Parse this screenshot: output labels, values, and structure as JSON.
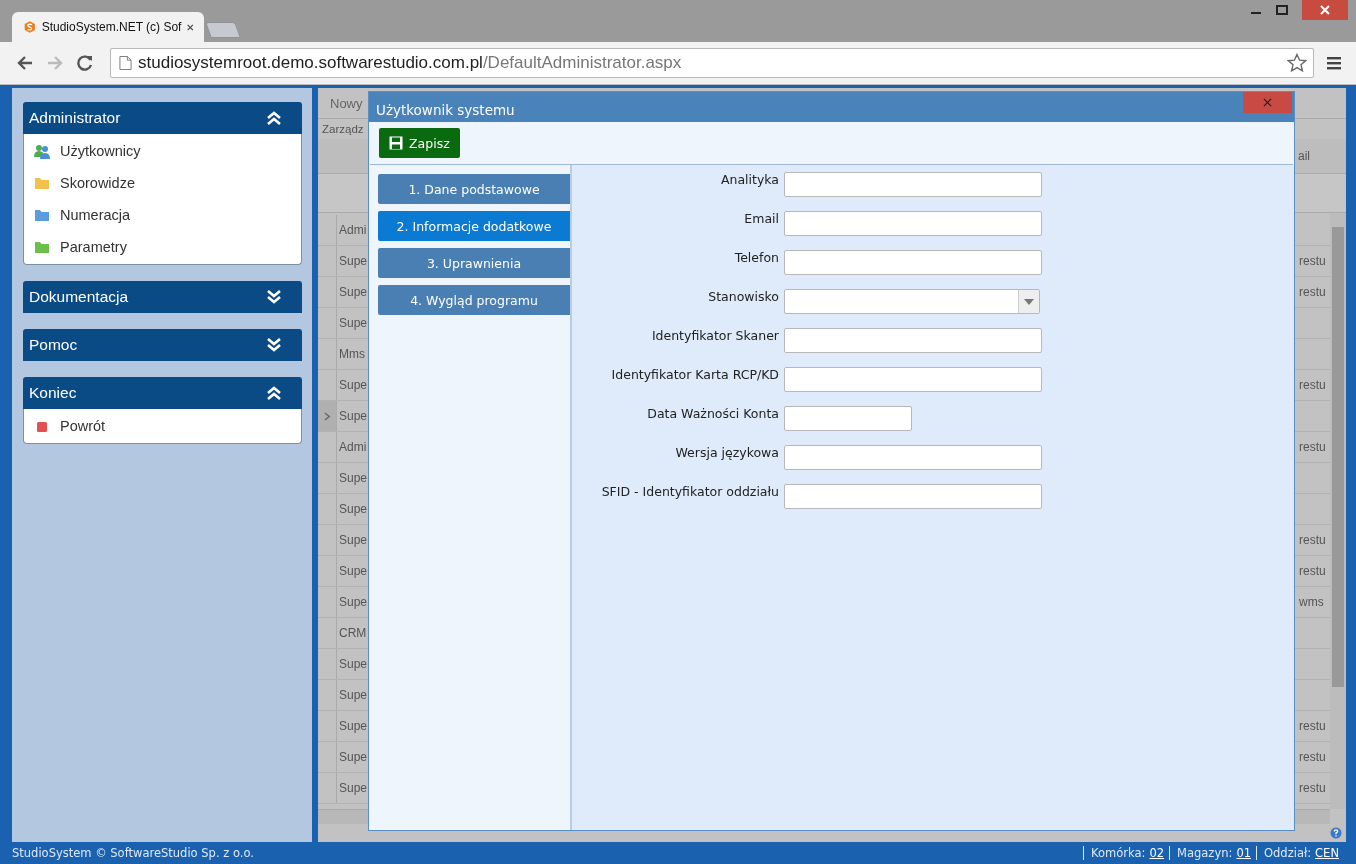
{
  "browser": {
    "tab_title": "StudioSystem.NET (c) Sof",
    "url_host": "studiosystemroot.demo.softwarestudio.com.pl",
    "url_path": "/DefaultAdministrator.aspx"
  },
  "sidebar": [
    {
      "title": "Administrator",
      "expanded": true,
      "items": [
        {
          "label": "Użytkownicy",
          "kind": "users"
        },
        {
          "label": "Skorowidze",
          "kind": "folder",
          "color": "#f2c14e"
        },
        {
          "label": "Numeracja",
          "kind": "folder",
          "color": "#5b9be0"
        },
        {
          "label": "Parametry",
          "kind": "folder",
          "color": "#6cc04a"
        }
      ]
    },
    {
      "title": "Dokumentacja",
      "expanded": false
    },
    {
      "title": "Pomoc",
      "expanded": false
    },
    {
      "title": "Koniec",
      "expanded": true,
      "items": [
        {
          "label": "Powrót",
          "kind": "stop"
        }
      ]
    }
  ],
  "grid": {
    "toolbar_button": "Nowy",
    "caption": "Zarządz",
    "header_cell": "ail",
    "rows": [
      {
        "cell_1": "Admi",
        "current": false
      },
      {
        "cell_1": "Supe",
        "cell_2": "restu",
        "current": false
      },
      {
        "cell_1": "Supe",
        "cell_2": "restu",
        "current": false
      },
      {
        "cell_1": "Supe",
        "current": false
      },
      {
        "cell_1": "Mms",
        "current": false
      },
      {
        "cell_1": "Supe",
        "cell_2": "restu",
        "current": false
      },
      {
        "cell_1": "Supe",
        "current": true
      },
      {
        "cell_1": "Admi",
        "cell_2": "restu",
        "current": false
      },
      {
        "cell_1": "Supe",
        "current": false
      },
      {
        "cell_1": "Supe",
        "current": false
      },
      {
        "cell_1": "Supe",
        "cell_2": "restu",
        "current": false
      },
      {
        "cell_1": "Supe",
        "cell_2": "restu",
        "current": false
      },
      {
        "cell_1": "Supe",
        "cell_2": "wms",
        "current": false
      },
      {
        "cell_1": "CRM",
        "current": false
      },
      {
        "cell_1": "Supe",
        "current": false
      },
      {
        "cell_1": "Supe",
        "current": false
      },
      {
        "cell_1": "Supe",
        "cell_2": "restu",
        "current": false
      },
      {
        "cell_1": "Supe",
        "cell_2": "restu",
        "current": false
      },
      {
        "cell_1": "Supe",
        "cell_2": "restu",
        "current": false
      }
    ]
  },
  "dialog": {
    "title": "Użytkownik systemu",
    "save_button": "Zapisz",
    "tabs": [
      {
        "label": "1. Dane podstawowe",
        "selected": false
      },
      {
        "label": "2. Informacje dodatkowe",
        "selected": true
      },
      {
        "label": "3. Uprawnienia",
        "selected": false
      },
      {
        "label": "4. Wygląd programu",
        "selected": false
      }
    ],
    "fields": [
      {
        "label": "Analityka",
        "kind": "text"
      },
      {
        "label": "Email",
        "kind": "text"
      },
      {
        "label": "Telefon",
        "kind": "text"
      },
      {
        "label": "Stanowisko",
        "kind": "select"
      },
      {
        "label": "Identyfikator Skaner",
        "kind": "text"
      },
      {
        "label": "Identyfikator Karta RCP/KD",
        "kind": "text"
      },
      {
        "label": "Data Ważności Konta",
        "kind": "date"
      },
      {
        "label": "Wersja językowa",
        "kind": "text"
      },
      {
        "label": "SFID - Identyfikator oddziału",
        "kind": "text"
      }
    ]
  },
  "status_bar": {
    "copyright": "StudioSystem © SoftwareStudio Sp. z o.o.",
    "items": [
      {
        "label": "Komórka:",
        "value": "02"
      },
      {
        "label": "Magazyn:",
        "value": "01"
      },
      {
        "label": "Oddział:",
        "value": "CEN"
      }
    ]
  }
}
